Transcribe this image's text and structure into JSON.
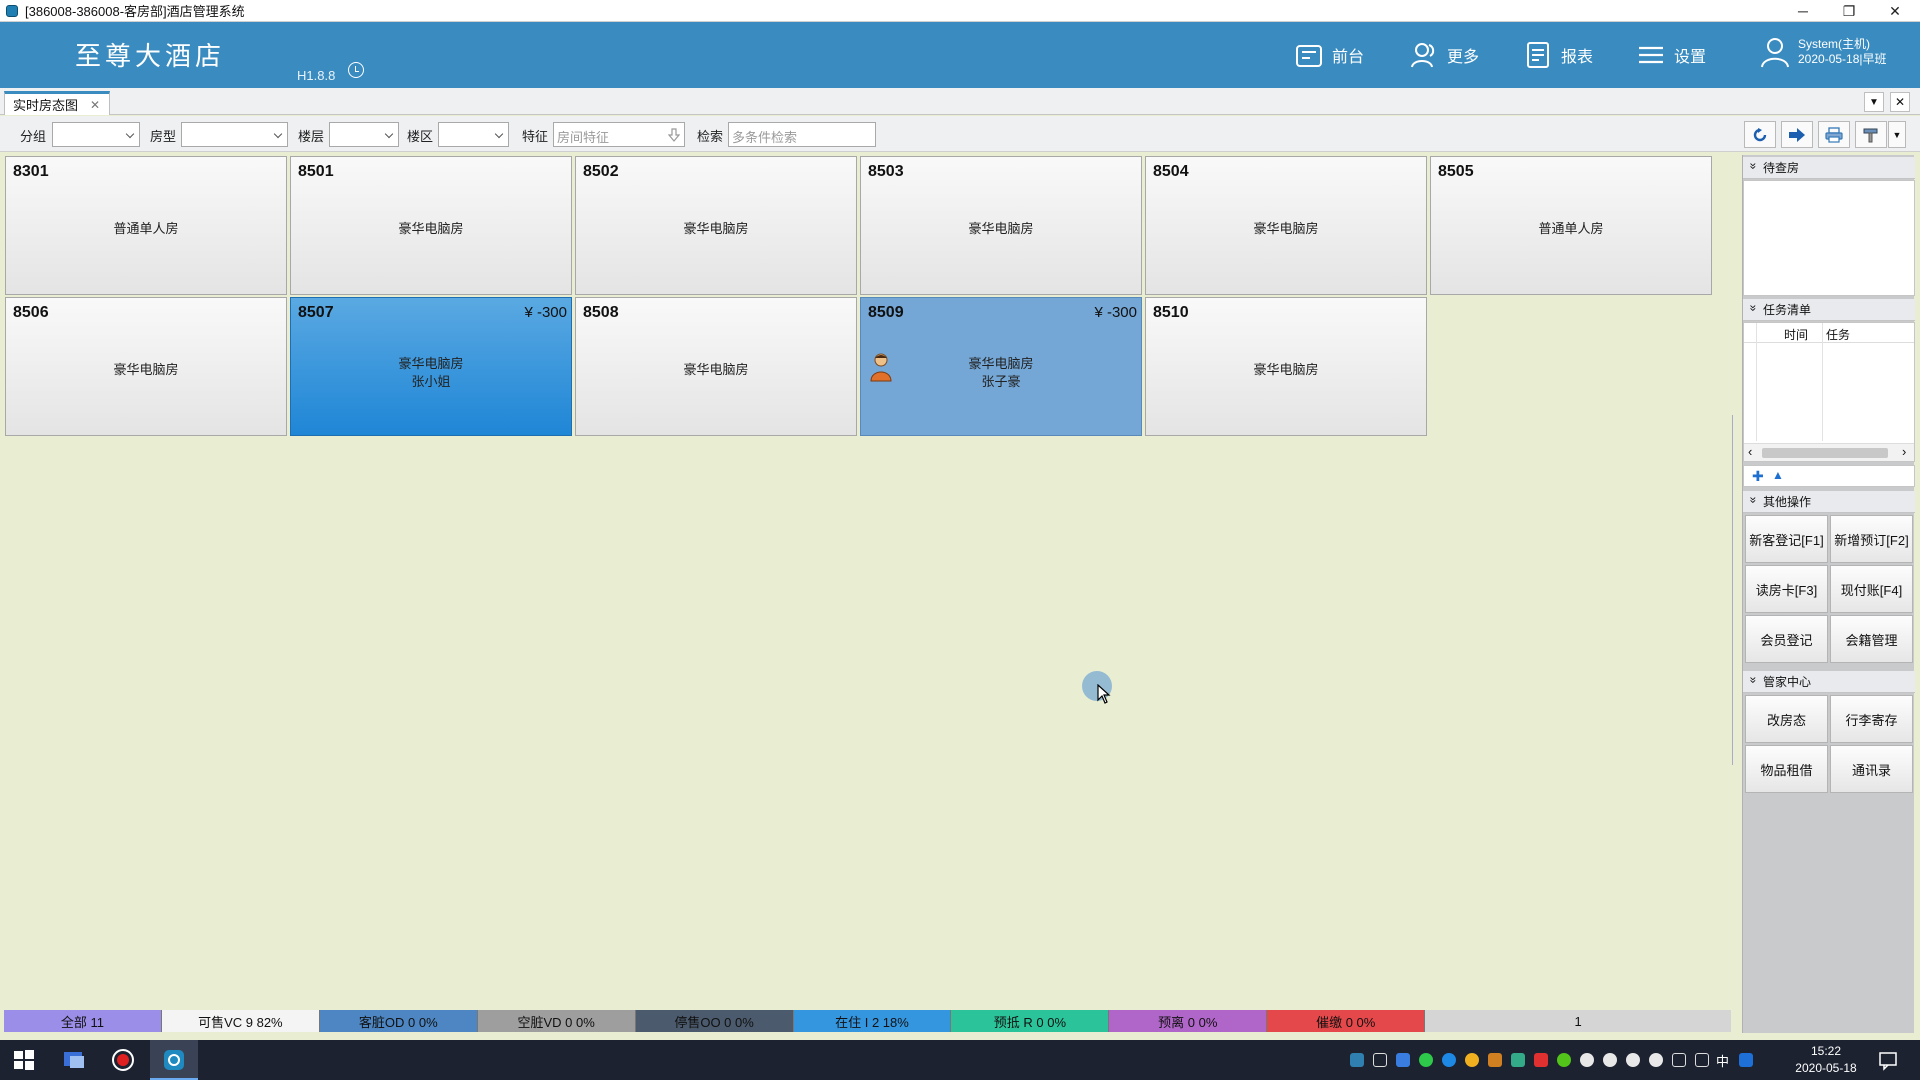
{
  "window": {
    "title": "[386008-386008-客房部]酒店管理系统",
    "min": "─",
    "max": "❐",
    "close": "✕"
  },
  "header": {
    "brand": "至尊大酒店",
    "version": "H1.8.8",
    "nav": [
      {
        "label": "前台",
        "icon": "front-desk-icon"
      },
      {
        "label": "更多",
        "icon": "users-icon"
      },
      {
        "label": "报表",
        "icon": "report-icon"
      },
      {
        "label": "设置",
        "icon": "menu-icon"
      }
    ],
    "user": {
      "name": "System(主机)",
      "date_shift": "2020-05-18|早班"
    }
  },
  "tabs": [
    {
      "label": "实时房态图",
      "close": "✕"
    }
  ],
  "tab_controls": {
    "dropdown": "▼",
    "close": "✕"
  },
  "filters": {
    "group_label": "分组",
    "room_type_label": "房型",
    "floor_label": "楼层",
    "zone_label": "楼区",
    "feature_label": "特征",
    "feature_placeholder": "房间特征",
    "search_label": "检索",
    "search_placeholder": "多条件检索"
  },
  "rooms": [
    {
      "number": "8301",
      "type": "普通单人房",
      "price": "",
      "guest": ""
    },
    {
      "number": "8501",
      "type": "豪华电脑房",
      "price": "",
      "guest": ""
    },
    {
      "number": "8502",
      "type": "豪华电脑房",
      "price": "",
      "guest": ""
    },
    {
      "number": "8503",
      "type": "豪华电脑房",
      "price": "",
      "guest": ""
    },
    {
      "number": "8504",
      "type": "豪华电脑房",
      "price": "",
      "guest": ""
    },
    {
      "number": "8505",
      "type": "普通单人房",
      "price": "",
      "guest": ""
    },
    {
      "number": "8506",
      "type": "豪华电脑房",
      "price": "",
      "guest": ""
    },
    {
      "number": "8507",
      "type": "豪华电脑房",
      "price": "¥ -300",
      "guest": "张小姐"
    },
    {
      "number": "8508",
      "type": "豪华电脑房",
      "price": "",
      "guest": ""
    },
    {
      "number": "8509",
      "type": "豪华电脑房",
      "price": "¥ -300",
      "guest": "张子豪"
    },
    {
      "number": "8510",
      "type": "豪华电脑房",
      "price": "",
      "guest": ""
    }
  ],
  "right_panel": {
    "pending_rooms": {
      "title": "待查房"
    },
    "tasks": {
      "title": "任务清单",
      "columns": [
        "时间",
        "任务"
      ],
      "add": "✚",
      "up": "▲",
      "left": "‹",
      "right": "›"
    },
    "other_ops": {
      "title": "其他操作",
      "buttons": [
        "新客登记[F1]",
        "新增预订[F2]",
        "读房卡[F3]",
        "现付账[F4]",
        "会员登记",
        "会籍管理"
      ]
    },
    "butler": {
      "title": "管家中心",
      "buttons": [
        "改房态",
        "行李寄存",
        "物品租借",
        "通讯录"
      ]
    }
  },
  "status_bar": [
    {
      "label": "全部 11",
      "color": "#9b8ee8"
    },
    {
      "label": "可售VC 9 82%",
      "color": "#f4f4f4"
    },
    {
      "label": "客脏OD 0 0%",
      "color": "#4d86c2"
    },
    {
      "label": "空脏VD 0 0%",
      "color": "#9e9e9e"
    },
    {
      "label": "停售OO 0 0%",
      "color": "#4b5a6c"
    },
    {
      "label": "在住 I 2 18%",
      "color": "#3596e0"
    },
    {
      "label": "预抵 R 0 0%",
      "color": "#2bc49a"
    },
    {
      "label": "预离 0 0%",
      "color": "#b066c8"
    },
    {
      "label": "催缴 0 0%",
      "color": "#e5484a"
    }
  ],
  "page_number": "1",
  "taskbar": {
    "time": "15:22",
    "date": "2020-05-18",
    "ime": "中"
  }
}
